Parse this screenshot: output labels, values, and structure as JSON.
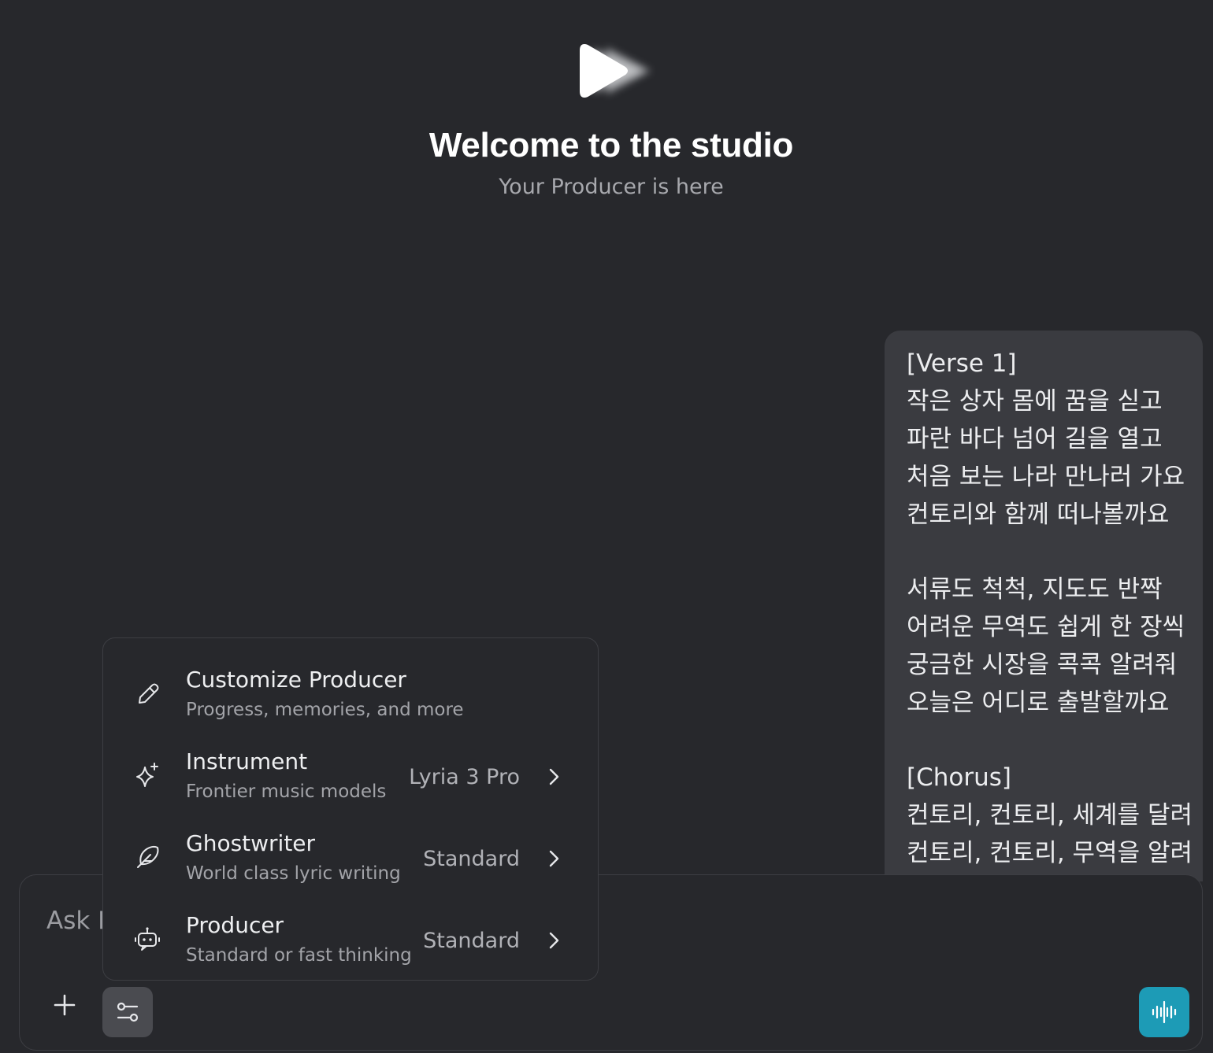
{
  "welcome": {
    "title": "Welcome to the studio",
    "subtitle": "Your Producer is here"
  },
  "lyrics": {
    "block1": [
      "[Verse 1]",
      "작은 상자 몸에 꿈을 싣고",
      "파란 바다 넘어 길을 열고",
      "처음 보는 나라 만나러 가요",
      "컨토리와 함께 떠나볼까요"
    ],
    "block2": [
      "서류도 척척, 지도도 반짝",
      "어려운 무역도 쉽게 한 장씩",
      "궁금한 시장을 콕콕 알려줘",
      "오늘은 어디로 출발할까요"
    ],
    "block3": [
      "[Chorus]",
      "컨토리, 컨토리, 세계를 달려",
      "컨토리, 컨토리, 무역을 알려"
    ]
  },
  "composer": {
    "placeholder": "Ask Producer"
  },
  "menu": {
    "items": [
      {
        "title": "Customize Producer",
        "description": "Progress, memories, and more",
        "value": "",
        "icon": "pencil-icon"
      },
      {
        "title": "Instrument",
        "description": "Frontier music models",
        "value": "Lyria 3 Pro",
        "icon": "sparkle-icon"
      },
      {
        "title": "Ghostwriter",
        "description": "World class lyric writing",
        "value": "Standard",
        "icon": "feather-icon"
      },
      {
        "title": "Producer",
        "description": "Standard or fast thinking",
        "value": "Standard",
        "icon": "robot-icon"
      }
    ]
  },
  "colors": {
    "background": "#27282c",
    "bubble": "#3a3b40",
    "voice_button": "#1d9bb6",
    "settings_button": "#4a4b50"
  }
}
